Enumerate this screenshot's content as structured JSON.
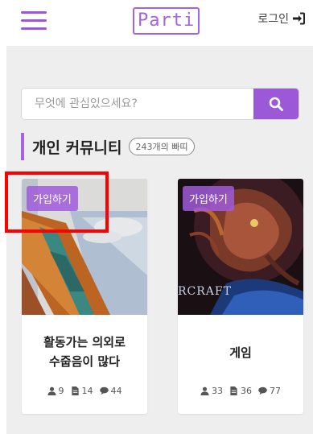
{
  "header": {
    "logo": "Parti",
    "login_label": "로그인"
  },
  "search": {
    "placeholder": "무엇에 관심있으세요?"
  },
  "section": {
    "title": "개인 커뮤니티",
    "count": "243개의 빠띠"
  },
  "cards": [
    {
      "join_label": "가입하기",
      "title_line1": "활동가는 의외로",
      "title_line2": "수줍음이 많다",
      "members": "9",
      "posts": "14",
      "comments": "44"
    },
    {
      "join_label": "가입하기",
      "title_line1": "게임",
      "title_line2": "",
      "members": "33",
      "posts": "36",
      "comments": "77",
      "image_text": "RCRAFT"
    }
  ],
  "colors": {
    "accent": "#9b59d8",
    "background": "#eeeeef",
    "highlight": "#ff0000"
  },
  "icons": [
    "menu-icon",
    "sign-in-icon",
    "search-icon",
    "user-icon",
    "document-icon",
    "comment-icon"
  ]
}
